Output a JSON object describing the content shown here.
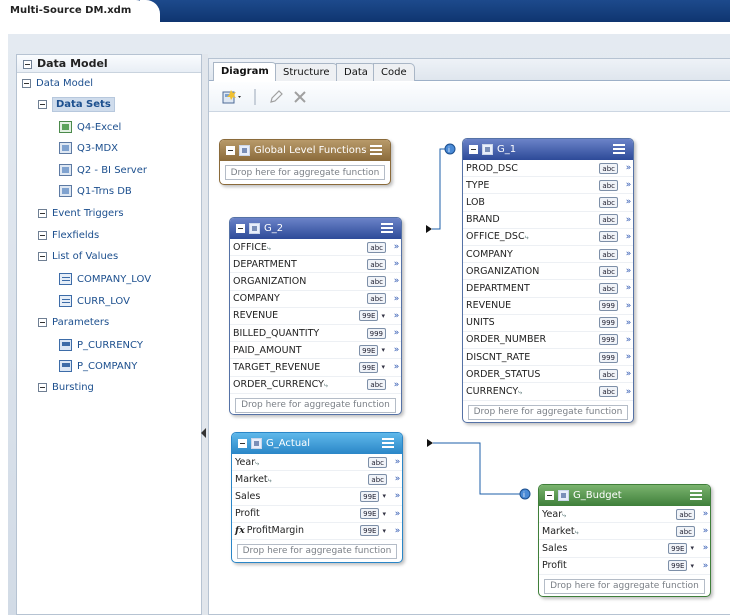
{
  "document_tab": "Multi-Source DM.xdm",
  "left_panel": {
    "title": "Data Model",
    "root": "Data Model",
    "data_sets": {
      "label": "Data Sets",
      "items": [
        "Q4-Excel",
        "Q3-MDX",
        "Q2 - BI Server",
        "Q1-Trns DB"
      ]
    },
    "event_triggers": "Event Triggers",
    "flexfields": "Flexfields",
    "list_of_values": {
      "label": "List of Values",
      "items": [
        "COMPANY_LOV",
        "CURR_LOV"
      ]
    },
    "parameters": {
      "label": "Parameters",
      "items": [
        "P_CURRENCY",
        "P_COMPANY"
      ]
    },
    "bursting": "Bursting"
  },
  "tabs": [
    "Diagram",
    "Structure",
    "Data",
    "Code"
  ],
  "active_tab": "Diagram",
  "badges": {
    "text": "abc",
    "number": "999",
    "number_dd": "99E"
  },
  "drop_text": "Drop here for aggregate function",
  "groups": {
    "global": {
      "title": "Global Level Functions"
    },
    "g2": {
      "title": "G_2",
      "rows": [
        "OFFICE",
        "DEPARTMENT",
        "ORGANIZATION",
        "COMPANY",
        "REVENUE",
        "BILLED_QUANTITY",
        "PAID_AMOUNT",
        "TARGET_REVENUE",
        "ORDER_CURRENCY"
      ]
    },
    "g1": {
      "title": "G_1",
      "rows": [
        "PROD_DSC",
        "TYPE",
        "LOB",
        "BRAND",
        "OFFICE_DSC",
        "COMPANY",
        "ORGANIZATION",
        "DEPARTMENT",
        "REVENUE",
        "UNITS",
        "ORDER_NUMBER",
        "DISCNT_RATE",
        "ORDER_STATUS",
        "CURRENCY"
      ]
    },
    "gactual": {
      "title": "G_Actual",
      "rows": [
        "Year",
        "Market",
        "Sales",
        "Profit",
        "ProfitMargin"
      ]
    },
    "gbudget": {
      "title": "G_Budget",
      "rows": [
        "Year",
        "Market",
        "Sales",
        "Profit"
      ]
    }
  },
  "colors": {
    "g_blue": "#2d4a98",
    "g_cyan": "#2a86c7",
    "g_green": "#3f7f3a",
    "g_brown": "#8a6a3a"
  }
}
